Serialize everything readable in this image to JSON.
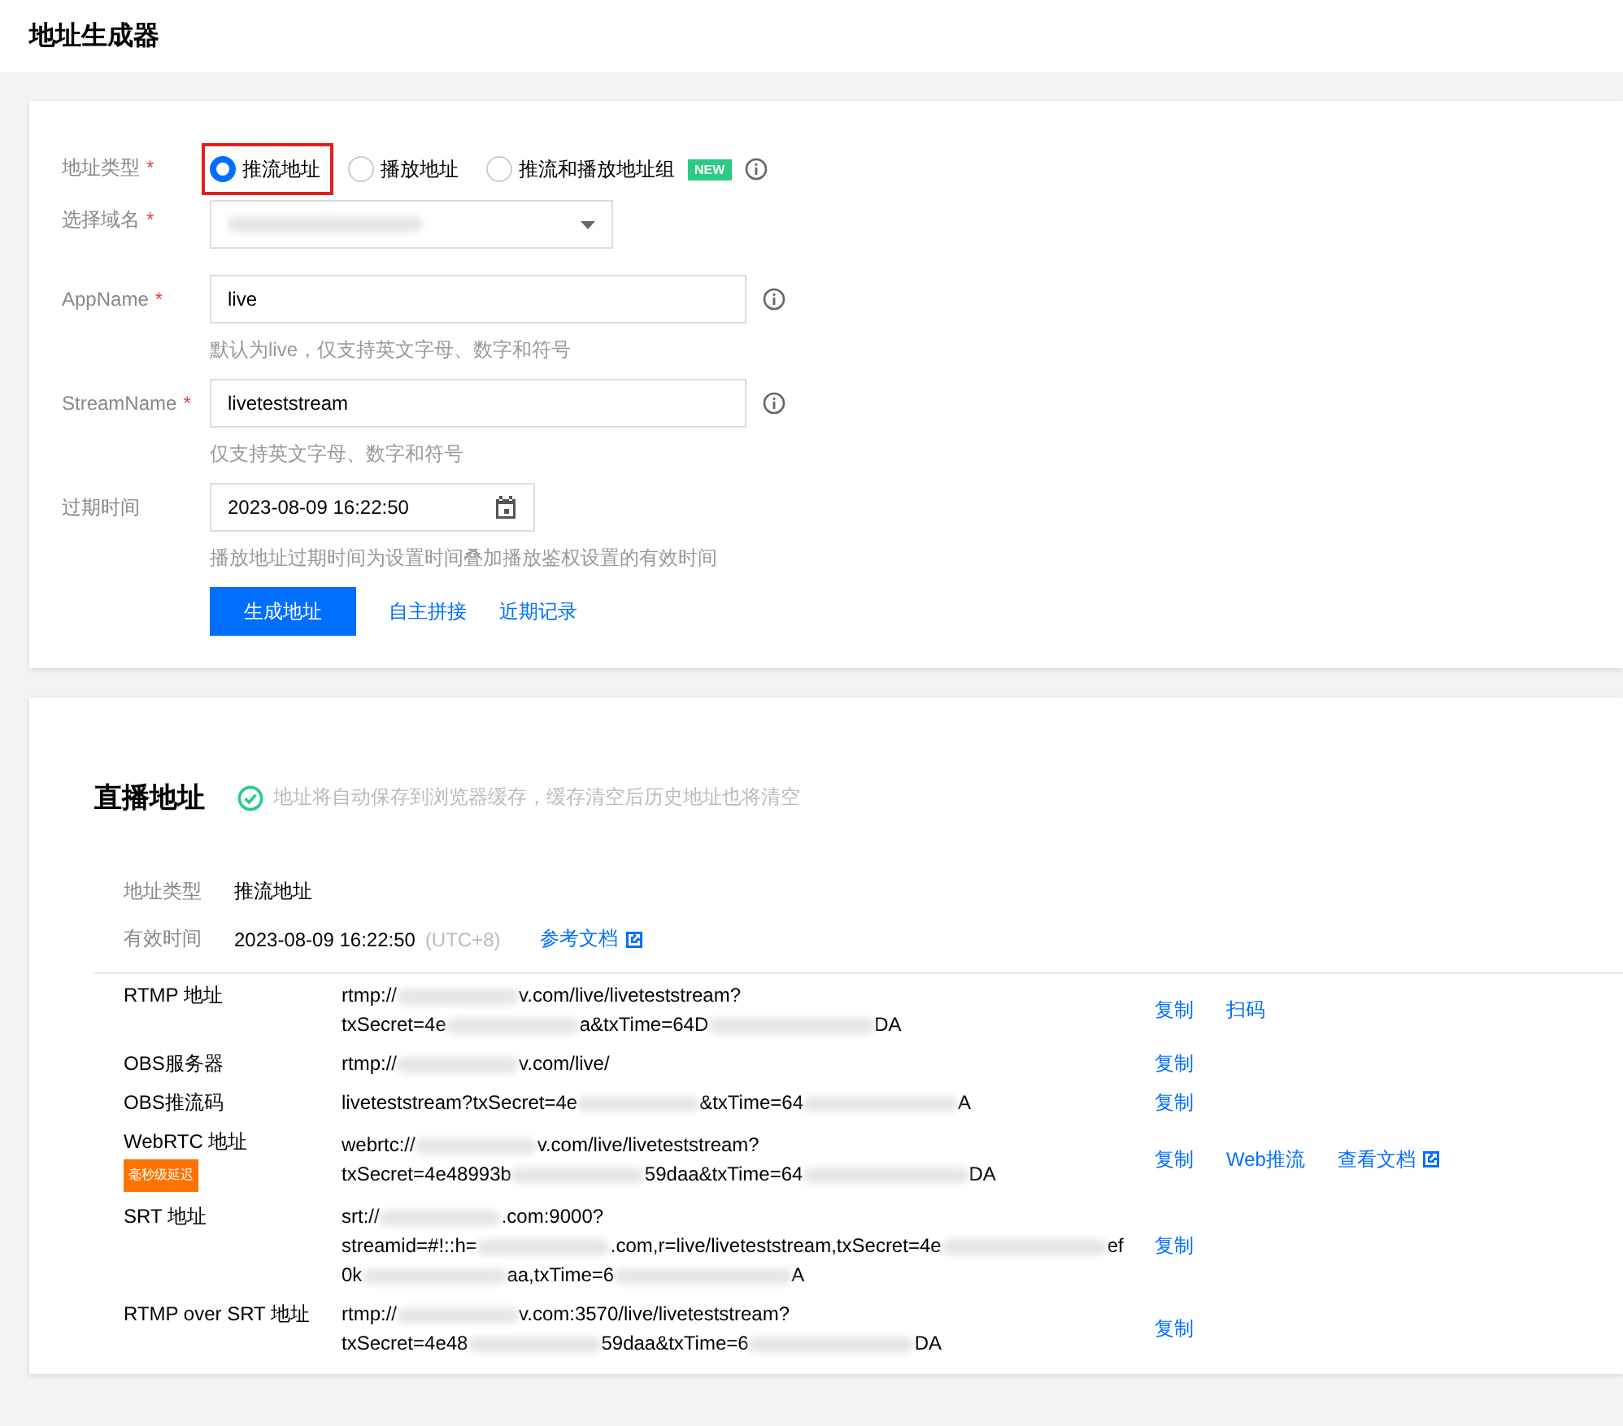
{
  "header": {
    "title": "地址生成器"
  },
  "form": {
    "type_field": {
      "label": "地址类型",
      "required_mark": "*",
      "options": [
        {
          "label": "推流地址",
          "selected": true,
          "highlighted": true
        },
        {
          "label": "播放地址",
          "selected": false,
          "highlighted": false
        },
        {
          "label": "推流和播放地址组",
          "selected": false,
          "highlighted": false,
          "badge": "NEW",
          "info": true
        }
      ]
    },
    "domain_field": {
      "label": "选择域名",
      "required_mark": "*"
    },
    "app_name": {
      "label": "AppName",
      "required_mark": "*",
      "value": "live",
      "hint": "默认为live，仅支持英文字母、数字和符号"
    },
    "stream_name": {
      "label": "StreamName",
      "required_mark": "*",
      "value": "liveteststream",
      "hint": "仅支持英文字母、数字和符号"
    },
    "expiry": {
      "label": "过期时间",
      "value": "2023-08-09 16:22:50",
      "hint": "播放地址过期时间为设置时间叠加播放鉴权设置的有效时间"
    },
    "actions": {
      "primary": "生成地址",
      "links": [
        "自主拼接",
        "近期记录"
      ]
    }
  },
  "result": {
    "title": "直播地址",
    "notice": "地址将自动保存到浏览器缓存，缓存清空后历史地址也将清空",
    "info": [
      {
        "label": "地址类型",
        "value": "推流地址"
      },
      {
        "label": "有效时间",
        "value": "2023-08-09 16:22:50",
        "suffix": "(UTC+8)",
        "link": "参考文档"
      }
    ],
    "rows": [
      {
        "label": "RTMP 地址",
        "lines": [
          [
            "rtmp://",
            "v.com/live/liveteststream?"
          ],
          [
            "txSecret=4e",
            "a&txTime=64D",
            "DA"
          ]
        ],
        "actions": [
          {
            "label": "复制",
            "external": false
          },
          {
            "label": "扫码",
            "external": false
          }
        ]
      },
      {
        "label": "OBS服务器",
        "lines": [
          [
            "rtmp://",
            "v.com/live/"
          ]
        ],
        "actions": [
          {
            "label": "复制",
            "external": false
          }
        ]
      },
      {
        "label": "OBS推流码",
        "lines": [
          [
            "liveteststream?txSecret=4e",
            "&txTime=64",
            "A"
          ]
        ],
        "actions": [
          {
            "label": "复制",
            "external": false
          }
        ]
      },
      {
        "label": "WebRTC 地址",
        "tag": "毫秒级延迟",
        "lines": [
          [
            "webrtc://",
            "v.com/live/liveteststream?"
          ],
          [
            "txSecret=4e48993b",
            "59daa&txTime=64",
            "DA"
          ]
        ],
        "actions": [
          {
            "label": "复制",
            "external": false
          },
          {
            "label": "Web推流",
            "external": false
          },
          {
            "label": "查看文档",
            "external": true
          }
        ]
      },
      {
        "label": "SRT 地址",
        "lines": [
          [
            "srt://",
            ".com:9000?"
          ],
          [
            "streamid=#!::h=",
            ".com,r=live/liveteststream,txSecret=4e",
            "ef"
          ],
          [
            "0k",
            "aa,txTime=6",
            "A"
          ]
        ],
        "actions": [
          {
            "label": "复制",
            "external": false
          }
        ]
      },
      {
        "label": "RTMP over SRT 地址",
        "lines": [
          [
            "rtmp://",
            "v.com:3570/live/liveteststream?"
          ],
          [
            "txSecret=4e48",
            "59daa&txTime=6",
            "DA"
          ]
        ],
        "actions": [
          {
            "label": "复制",
            "external": false
          }
        ]
      }
    ]
  }
}
